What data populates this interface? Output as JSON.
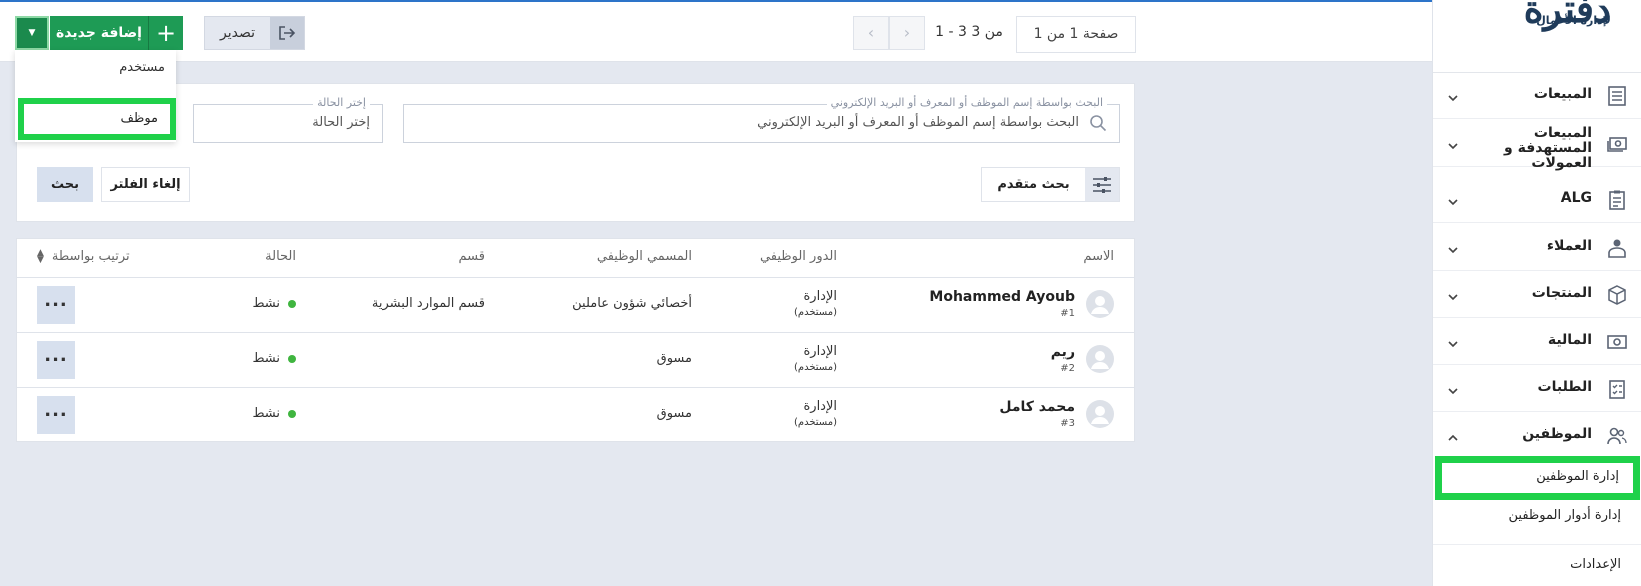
{
  "toolbar": {
    "add_label": "إضافة جديدة",
    "export_label": "تصدير",
    "page_label": "صفحة 1 من 1",
    "range_label": "1 - 3 من 3"
  },
  "add_menu": {
    "items": [
      "مستخدم",
      "موظف"
    ]
  },
  "filter": {
    "search_legend": "البحث بواسطة إسم الموظف أو المعرف أو البريد الإلكتروني",
    "search_placeholder": "البحث بواسطة إسم الموظف أو المعرف أو البريد الإلكتروني",
    "status_legend": "إختر الحالة",
    "status_placeholder": "إختر الحالة",
    "advanced_label": "بحث متقدم",
    "clear_label": "إلغاء الفلتر",
    "search_button": "بحث"
  },
  "table": {
    "headers": {
      "name": "الاسم",
      "role": "الدور الوظيفي",
      "job_title": "المسمي الوظيفي",
      "department": "قسم",
      "status": "الحالة",
      "sort": "ترتيب بواسطة"
    },
    "rows": [
      {
        "name": "Mohammed Ayoub",
        "number": "#1",
        "role": "الإدارة",
        "role_sub": "(مستخدم)",
        "job_title": "أخصائي شؤون عاملين",
        "department": "قسم الموارد البشرية",
        "status": "نشط"
      },
      {
        "name": "ريم",
        "number": "#2",
        "role": "الإدارة",
        "role_sub": "(مستخدم)",
        "job_title": "مسوق",
        "department": "",
        "status": "نشط"
      },
      {
        "name": "محمد كامل",
        "number": "#3",
        "role": "الإدارة",
        "role_sub": "(مستخدم)",
        "job_title": "مسوق",
        "department": "",
        "status": "نشط"
      }
    ],
    "more_label": "..."
  },
  "sidebar": {
    "logo_text": "دفترة",
    "logo_tagline": "لإدارة الأعمال",
    "items": [
      {
        "label": "المبيعات",
        "icon": "invoice-icon"
      },
      {
        "label": "المبيعات المستهدفة و العمولات",
        "icon": "money-icon"
      },
      {
        "label": "ALG",
        "icon": "clipboard-icon"
      },
      {
        "label": "العملاء",
        "icon": "client-icon"
      },
      {
        "label": "المنتجات",
        "icon": "box-icon"
      },
      {
        "label": "المالية",
        "icon": "finance-icon"
      },
      {
        "label": "الطلبات",
        "icon": "checklist-icon"
      },
      {
        "label": "الموظفين",
        "icon": "employees-icon"
      }
    ],
    "sub_items": [
      "إدارة الموظفين",
      "إدارة أدوار الموظفين",
      "الإعدادات"
    ]
  },
  "colors": {
    "primary_green": "#1e9b55",
    "highlight": "#1fd14a",
    "status_active": "#3fb53f"
  }
}
